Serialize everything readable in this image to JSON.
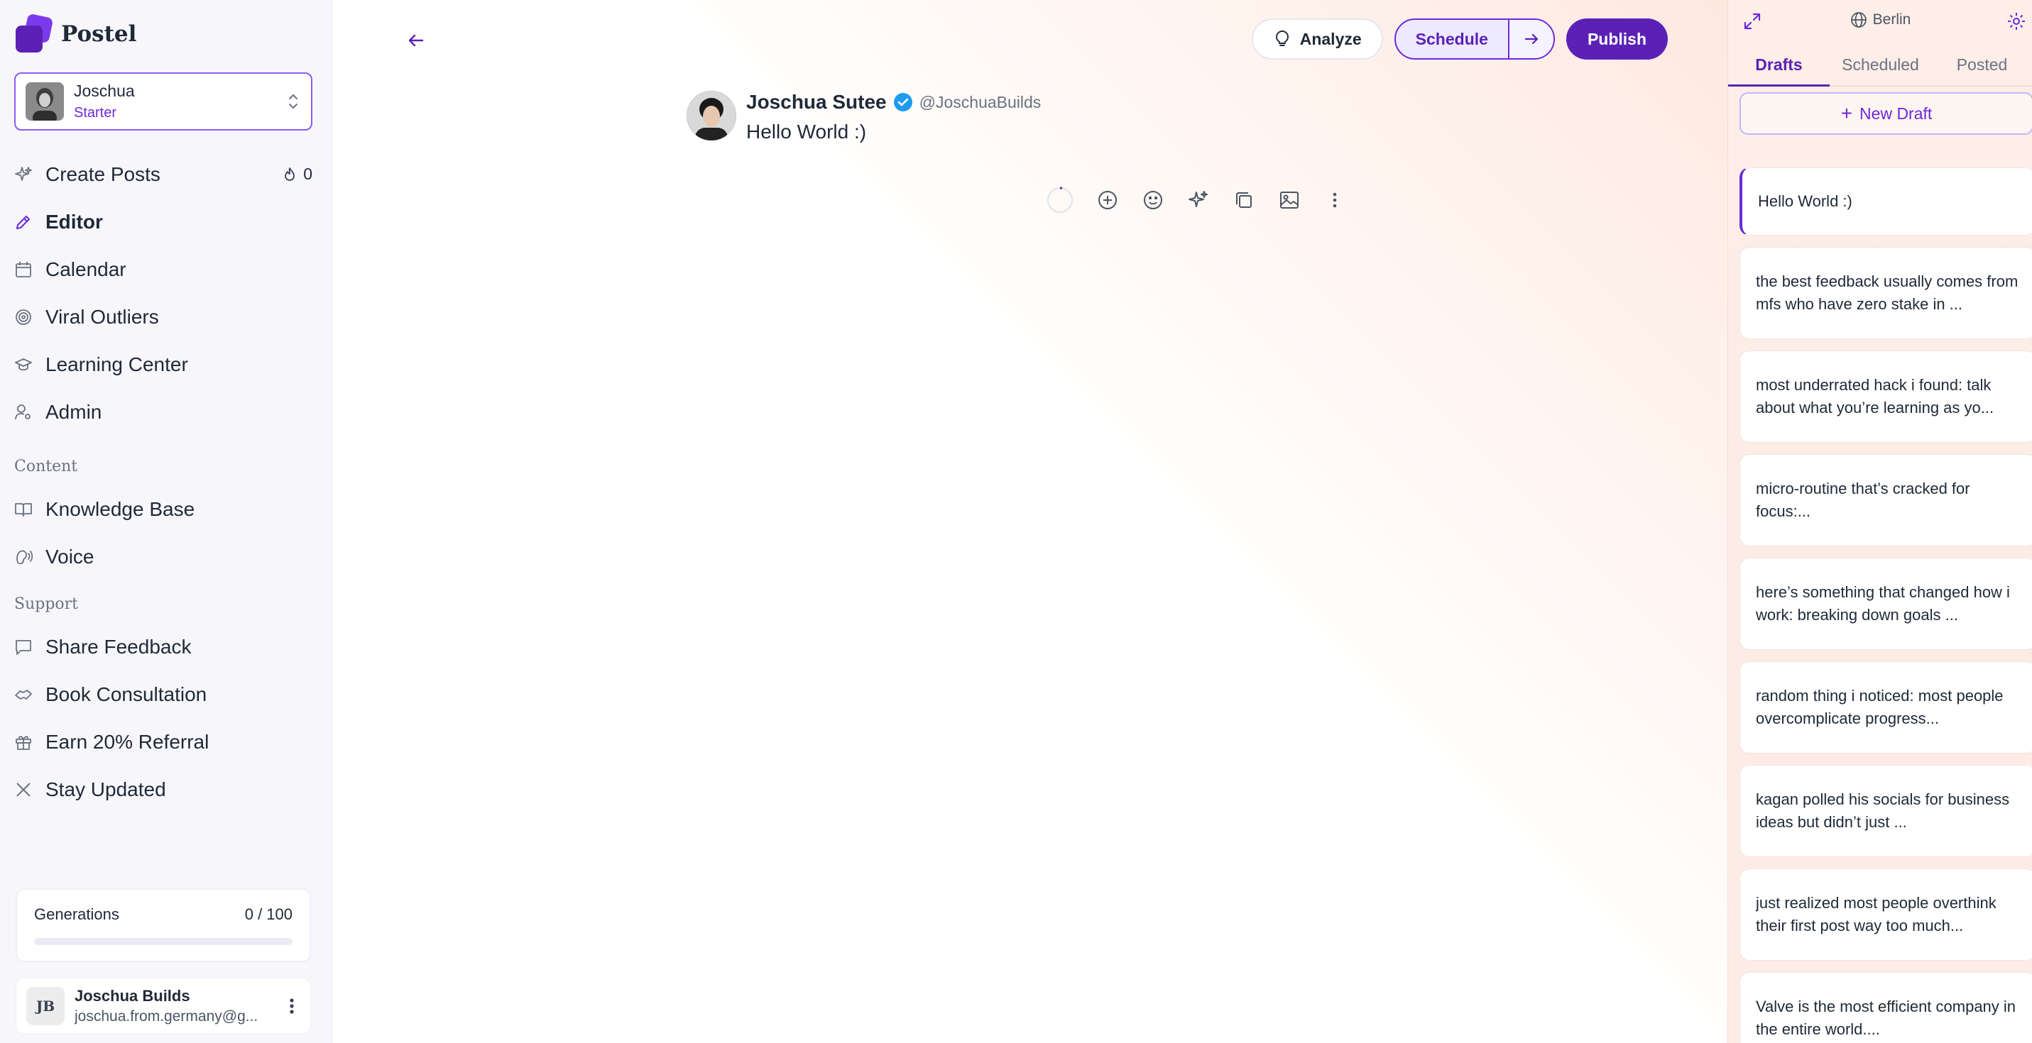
{
  "app": {
    "name": "Postel"
  },
  "account": {
    "name": "Joschua",
    "plan": "Starter"
  },
  "nav": {
    "create_posts": {
      "label": "Create Posts",
      "count": "0"
    },
    "editor": "Editor",
    "calendar": "Calendar",
    "viral_outliers": "Viral Outliers",
    "learning_center": "Learning Center",
    "admin": "Admin"
  },
  "content_section": {
    "label": "Content",
    "knowledge_base": "Knowledge Base",
    "voice": "Voice"
  },
  "support_section": {
    "label": "Support",
    "share_feedback": "Share Feedback",
    "book_consultation": "Book Consultation",
    "earn_referral": "Earn 20% Referral",
    "stay_updated": "Stay Updated"
  },
  "generations": {
    "label": "Generations",
    "value": "0 / 100",
    "progress": 0
  },
  "user": {
    "initials": "JB",
    "name": "Joschua Builds",
    "email": "joschua.from.germany@g..."
  },
  "toolbar": {
    "analyze": "Analyze",
    "schedule": "Schedule",
    "publish": "Publish"
  },
  "post": {
    "author": "Joschua Sutee",
    "handle": "@JoschuaBuilds",
    "text": "Hello World :)"
  },
  "panel": {
    "timezone": "Berlin",
    "tabs": [
      "Drafts",
      "Scheduled",
      "Posted"
    ],
    "new_draft": "New Draft",
    "drafts": [
      "Hello World :)",
      "the best feedback usually comes from mfs who have zero stake in ...",
      "most underrated hack i found: talk about what you’re learning as yo...",
      "micro-routine that’s cracked for focus:...",
      "here’s something that changed how i work: breaking down goals ...",
      "random thing i noticed: most people overcomplicate progress...",
      "kagan polled his socials for business ideas but didn’t just ...",
      "just realized most people overthink their first post way too much...",
      "Valve is the most efficient company in the entire world...."
    ]
  },
  "colors": {
    "accent": "#5b21b6",
    "accent_light": "#ede9fe",
    "verified": "#1d9bf0"
  }
}
